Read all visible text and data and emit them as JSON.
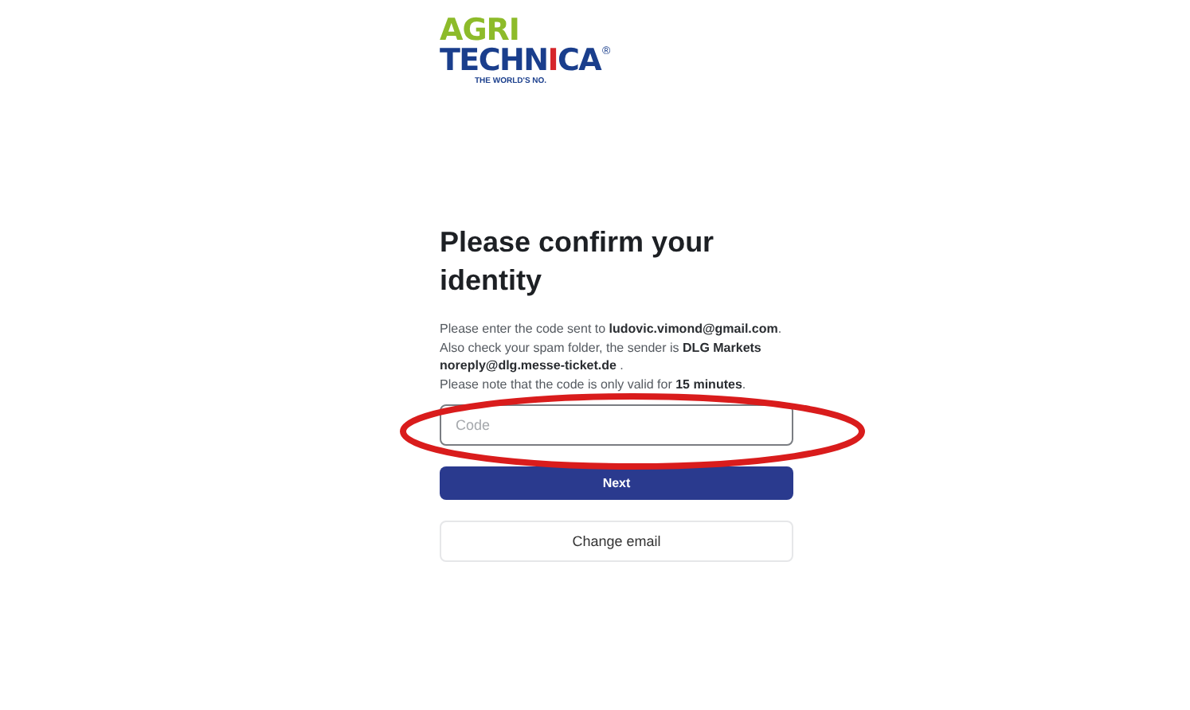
{
  "logo": {
    "line_1": "AGRI",
    "line_2_start": "TECHN",
    "line_2_mark": "I",
    "line_2_end": "CA",
    "registered": "®",
    "tagline": "THE WORLD'S NO."
  },
  "title": "Please confirm your identity",
  "message": [
    "Please enter the code sent to **ludovic.vimond@gmail.com**.",
    "Also check your spam folder, the sender is **DLG Markets**",
    "**noreply@dlg.messe-ticket.de** .",
    "Please note that the code is only valid for **15 minutes**."
  ],
  "code_field": {
    "placeholder": "Code"
  },
  "buttons": [
    {
      "label": "Next",
      "kind": "primary"
    },
    {
      "label": "Change email",
      "kind": "secondary"
    }
  ],
  "annotation": {
    "kind": "ellipse",
    "color": "#d91c1c"
  }
}
